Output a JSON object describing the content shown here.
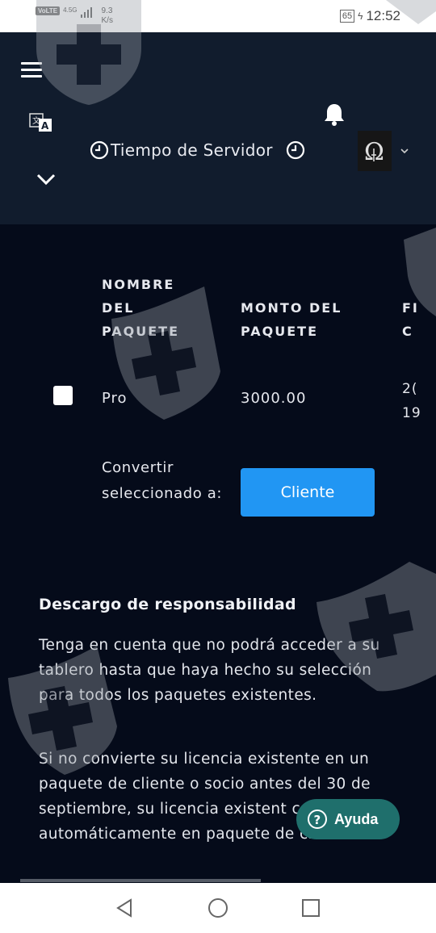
{
  "status_bar": {
    "carrier_badge": "VoLTE",
    "network_type": "4.5G",
    "network_speed": "9.3",
    "network_speed_unit": "K/s",
    "battery_level": "65",
    "time": "12:52"
  },
  "header": {
    "server_time_label": "Tiempo de Servidor"
  },
  "table": {
    "headers": {
      "package_name": [
        "NOMBRE",
        "DEL",
        "PAQUETE"
      ],
      "package_amount": [
        "MONTO DEL",
        "PAQUETE"
      ],
      "date_partial": [
        "FI",
        "C"
      ]
    },
    "row": {
      "name": "Pro",
      "amount": "3000.00",
      "date_partial": [
        "2(",
        "19"
      ]
    },
    "convert_label": "Convertir seleccionado a:",
    "convert_button": "Cliente"
  },
  "disclaimer": {
    "title": "Descargo de responsabilidad",
    "paragraph1": "Tenga en cuenta que no podrá acceder a su tablero hasta que haya hecho su selección para todos los paquetes existentes.",
    "paragraph2": "Si no convierte su licencia existente en un paquete de cliente o socio antes del 30 de septiembre, su licencia existent convertirá automáticamente en paquete de cliente."
  },
  "help_button": {
    "label": "Ayuda"
  },
  "colors": {
    "app_bar": "#111c2d",
    "page_background": "#050b1a",
    "primary_button": "#2196f3",
    "help_button": "#1f6f6c"
  }
}
